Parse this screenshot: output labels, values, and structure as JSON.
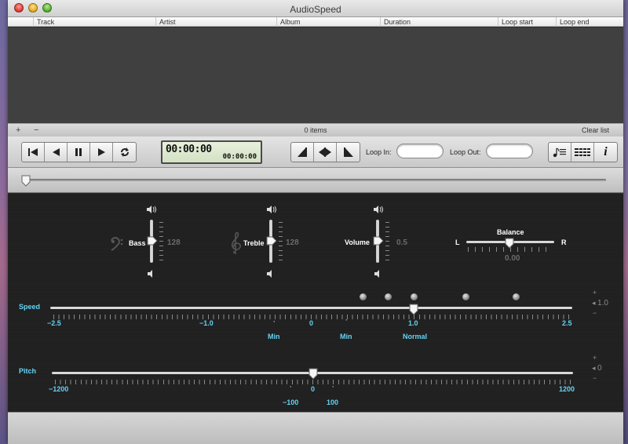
{
  "window": {
    "title": "AudioSpeed"
  },
  "table": {
    "columns": [
      "Track",
      "Artist",
      "Album",
      "Duration",
      "Loop start",
      "Loop end"
    ]
  },
  "list_bar": {
    "add": "+",
    "remove": "−",
    "count": "0 items",
    "clear": "Clear list"
  },
  "toolbar": {
    "time_main": "00:00:00",
    "time_sub": "00:00:00",
    "loop_in_label": "Loop In:",
    "loop_out_label": "Loop Out:",
    "loop_in_value": "",
    "loop_out_value": "",
    "info_glyph": "i"
  },
  "tone": {
    "bass": {
      "label": "Bass",
      "value": "128"
    },
    "treble": {
      "label": "Treble",
      "value": "128"
    },
    "volume": {
      "label": "Volume",
      "value": "0.5"
    },
    "balance": {
      "label": "Balance",
      "left": "L",
      "right": "R",
      "value": "0.00"
    }
  },
  "speed": {
    "label": "Speed",
    "value": "1.0",
    "scale": [
      "−2.5",
      "−1.0",
      "0",
      "1.0",
      "2.5"
    ],
    "marks": [
      "Min",
      "Min",
      "Normal"
    ]
  },
  "pitch": {
    "label": "Pitch",
    "value": "0",
    "scale": [
      "−1200",
      "0",
      "1200"
    ],
    "marks": [
      "−100",
      "100"
    ]
  },
  "stepper": {
    "up": "+",
    "down": "−"
  },
  "icons": {
    "close": "close-icon",
    "minimize": "minimize-icon",
    "zoom": "zoom-icon",
    "skip_start": "skip-start-icon",
    "rewind": "rewind-icon",
    "pause": "pause-icon",
    "play": "play-icon",
    "repeat": "repeat-icon",
    "loop_start": "loop-start-icon",
    "loop_shift": "loop-shift-icon",
    "loop_end": "loop-end-icon",
    "playlist": "playlist-icon",
    "equalizer": "equalizer-icon",
    "info": "info-icon",
    "bass_clef": "bass-clef-icon",
    "treble_clef": "treble-clef-icon",
    "speaker_high": "speaker-high-icon",
    "speaker_low": "speaker-low-icon"
  },
  "colors": {
    "accent_cyan": "#66d3f2",
    "panel_dark": "#222222",
    "lcd_green": "#dde9cf"
  }
}
